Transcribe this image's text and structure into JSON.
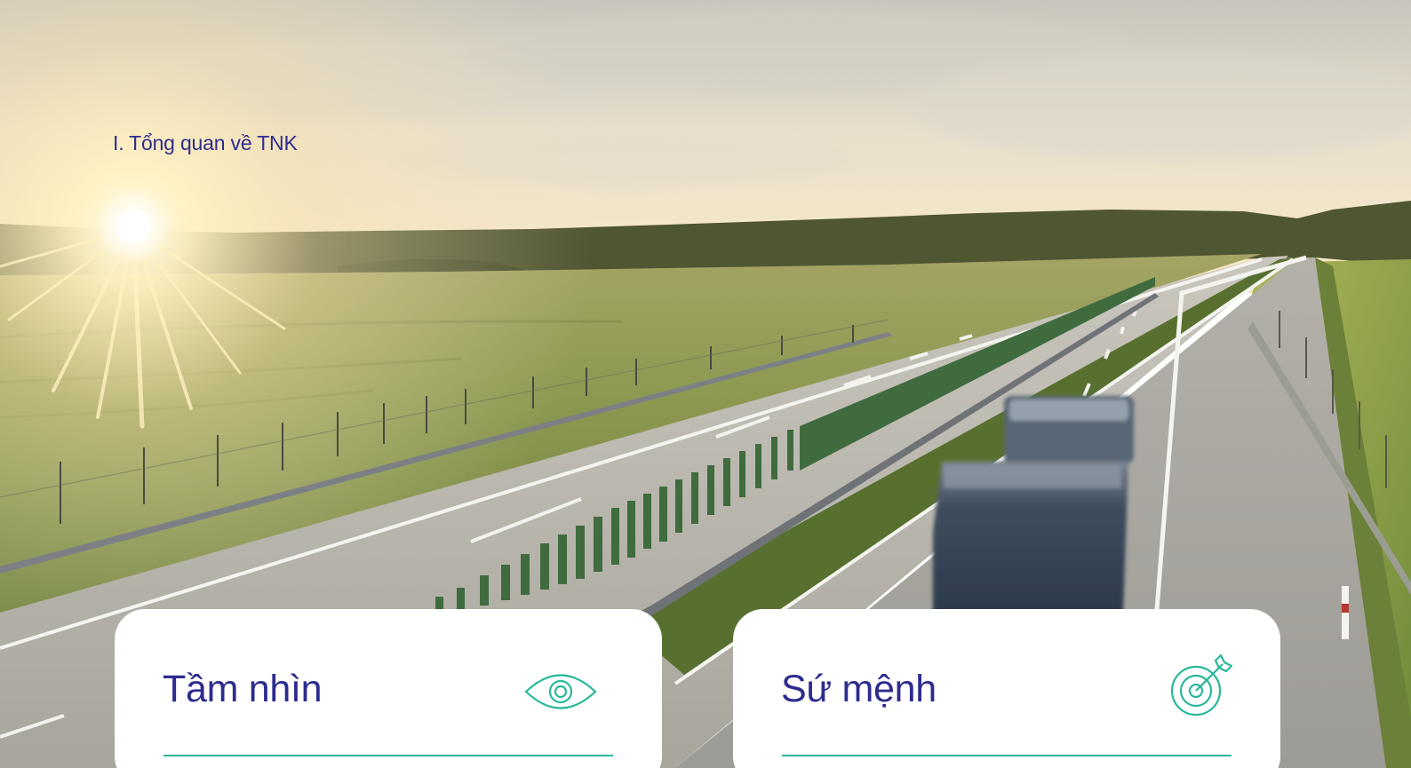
{
  "header": {
    "section_title": "I. Tổng quan về TNK"
  },
  "cards": [
    {
      "title": "Tầm nhìn",
      "icon": "eye-icon"
    },
    {
      "title": "Sứ mệnh",
      "icon": "target-arrow-icon"
    }
  ],
  "hero": {
    "icon": "highway-sunrise-photo"
  },
  "colors": {
    "title_text": "#2d2c8e",
    "accent": "#29b89a",
    "card_bg": "#ffffff"
  }
}
